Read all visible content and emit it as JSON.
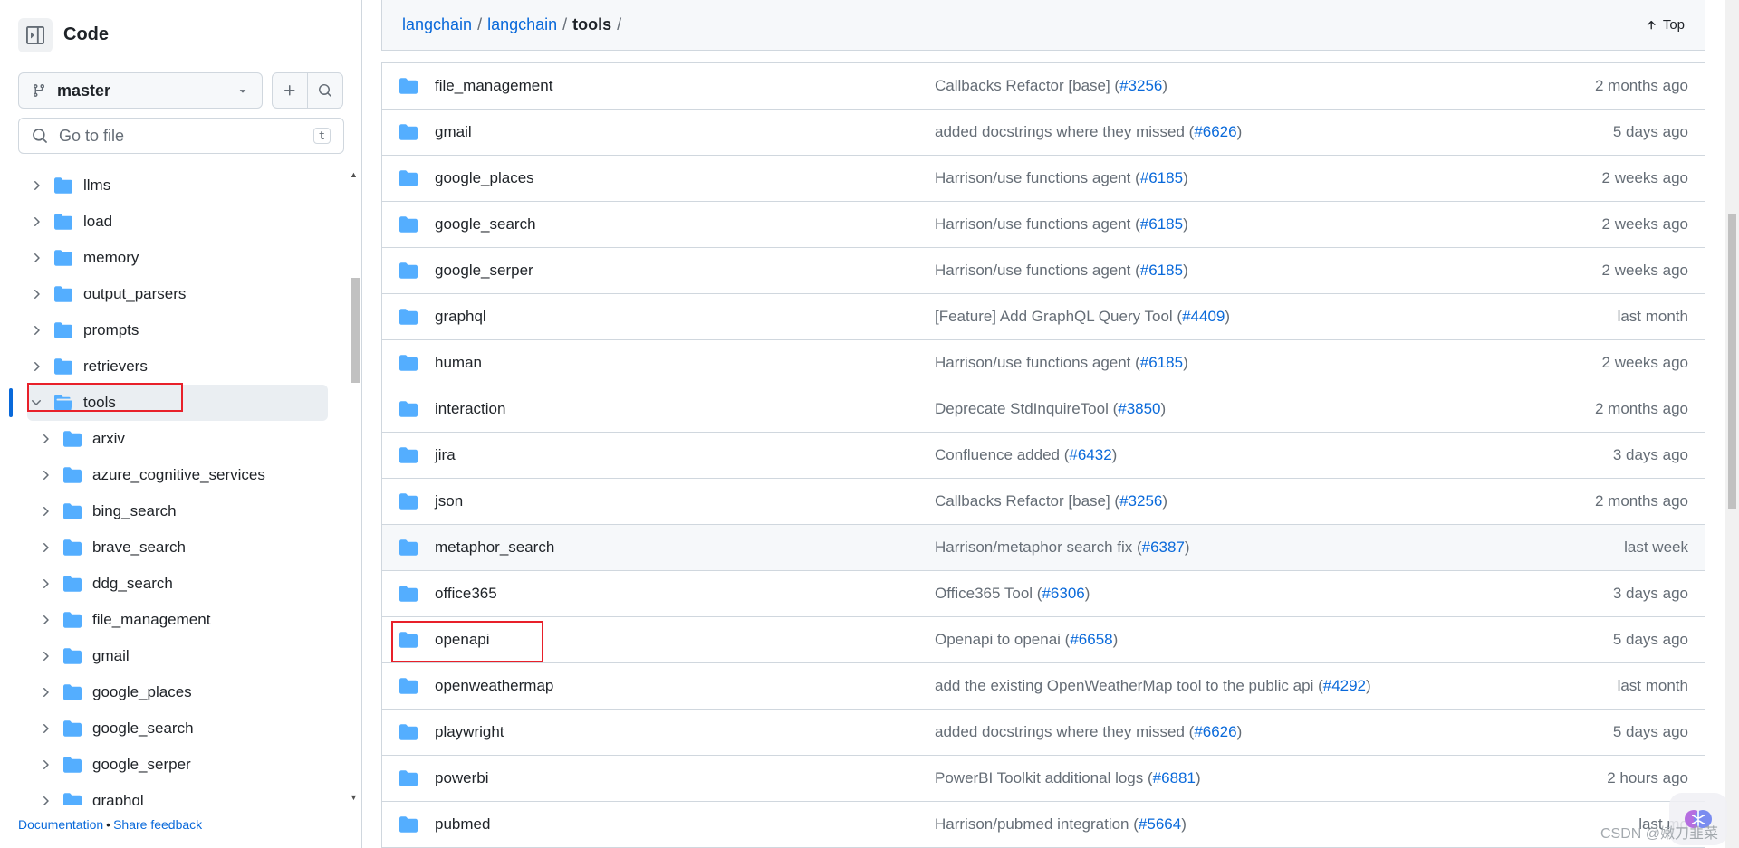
{
  "sidebar": {
    "title": "Code",
    "branch": "master",
    "goto_placeholder": "Go to file",
    "goto_shortcut": "t",
    "tree": [
      {
        "label": "llms",
        "expanded": false
      },
      {
        "label": "load",
        "expanded": false
      },
      {
        "label": "memory",
        "expanded": false
      },
      {
        "label": "output_parsers",
        "expanded": false
      },
      {
        "label": "prompts",
        "expanded": false
      },
      {
        "label": "retrievers",
        "expanded": false
      },
      {
        "label": "tools",
        "expanded": true,
        "active": true
      },
      {
        "label": "arxiv",
        "expanded": false
      },
      {
        "label": "azure_cognitive_services",
        "expanded": false
      },
      {
        "label": "bing_search",
        "expanded": false
      },
      {
        "label": "brave_search",
        "expanded": false
      },
      {
        "label": "ddg_search",
        "expanded": false
      },
      {
        "label": "file_management",
        "expanded": false
      },
      {
        "label": "gmail",
        "expanded": false
      },
      {
        "label": "google_places",
        "expanded": false
      },
      {
        "label": "google_search",
        "expanded": false
      },
      {
        "label": "google_serper",
        "expanded": false
      },
      {
        "label": "graphql",
        "expanded": false
      }
    ],
    "footer": {
      "documentation": "Documentation",
      "separator": "•",
      "feedback": "Share feedback"
    }
  },
  "breadcrumb": {
    "repo": "langchain",
    "folder": "langchain",
    "current": "tools",
    "top_label": "Top"
  },
  "files": [
    {
      "name": "file_management",
      "message": "Callbacks Refactor [base] (",
      "pr": "#3256",
      "time": "2 months ago"
    },
    {
      "name": "gmail",
      "message": "added docstrings where they missed (",
      "pr": "#6626",
      "time": "5 days ago"
    },
    {
      "name": "google_places",
      "message": "Harrison/use functions agent (",
      "pr": "#6185",
      "time": "2 weeks ago"
    },
    {
      "name": "google_search",
      "message": "Harrison/use functions agent (",
      "pr": "#6185",
      "time": "2 weeks ago"
    },
    {
      "name": "google_serper",
      "message": "Harrison/use functions agent (",
      "pr": "#6185",
      "time": "2 weeks ago"
    },
    {
      "name": "graphql",
      "message": "[Feature] Add GraphQL Query Tool (",
      "pr": "#4409",
      "time": "last month"
    },
    {
      "name": "human",
      "message": "Harrison/use functions agent (",
      "pr": "#6185",
      "time": "2 weeks ago"
    },
    {
      "name": "interaction",
      "message": "Deprecate StdInquireTool (",
      "pr": "#3850",
      "time": "2 months ago"
    },
    {
      "name": "jira",
      "message": "Confluence added (",
      "pr": "#6432",
      "time": "3 days ago"
    },
    {
      "name": "json",
      "message": "Callbacks Refactor [base] (",
      "pr": "#3256",
      "time": "2 months ago"
    },
    {
      "name": "metaphor_search",
      "message": "Harrison/metaphor search fix (",
      "pr": "#6387",
      "time": "last week"
    },
    {
      "name": "office365",
      "message": "Office365 Tool (",
      "pr": "#6306",
      "time": "3 days ago"
    },
    {
      "name": "openapi",
      "message": "Openapi to openai (",
      "pr": "#6658",
      "time": "5 days ago"
    },
    {
      "name": "openweathermap",
      "message": "add the existing OpenWeatherMap tool to the public api (",
      "pr": "#4292",
      "time": "last month"
    },
    {
      "name": "playwright",
      "message": "added docstrings where they missed (",
      "pr": "#6626",
      "time": "5 days ago"
    },
    {
      "name": "powerbi",
      "message": "PowerBI Toolkit additional logs (",
      "pr": "#6881",
      "time": "2 hours ago"
    },
    {
      "name": "pubmed",
      "message": "Harrison/pubmed integration (",
      "pr": "#5664",
      "time": "last mo"
    }
  ],
  "watermark": "CSDN @嫩刀韭菜",
  "colors": {
    "folder": "#54aeff",
    "link": "#0969da",
    "highlight_box": "#e8202a",
    "active_bar": "#0969da"
  }
}
